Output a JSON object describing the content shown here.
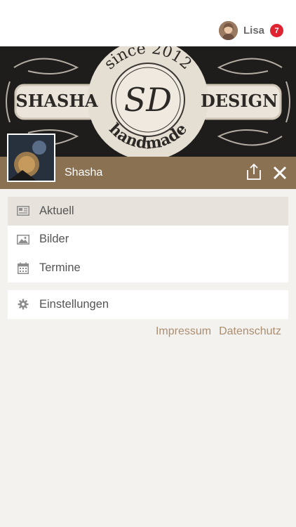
{
  "user": {
    "name": "Lisa",
    "notifications": "7"
  },
  "banner": {
    "left_text": "SHASHA",
    "right_text": "DESIGN",
    "arc_top": "since 2012",
    "arc_bottom": "handmade",
    "monogram": "SD"
  },
  "page": {
    "name": "Shasha"
  },
  "menu": {
    "items": [
      {
        "label": "Aktuell",
        "icon": "newspaper-icon",
        "active": true
      },
      {
        "label": "Bilder",
        "icon": "image-icon",
        "active": false
      },
      {
        "label": "Termine",
        "icon": "calendar-icon",
        "active": false
      }
    ],
    "settings": {
      "label": "Einstellungen",
      "icon": "gear-icon"
    }
  },
  "footer": {
    "impressum": "Impressum",
    "datenschutz": "Datenschutz"
  },
  "colors": {
    "namebar": "#8a7152",
    "accent_link": "#a98e71",
    "badge": "#e02331",
    "active_row": "#e7e2dc"
  }
}
